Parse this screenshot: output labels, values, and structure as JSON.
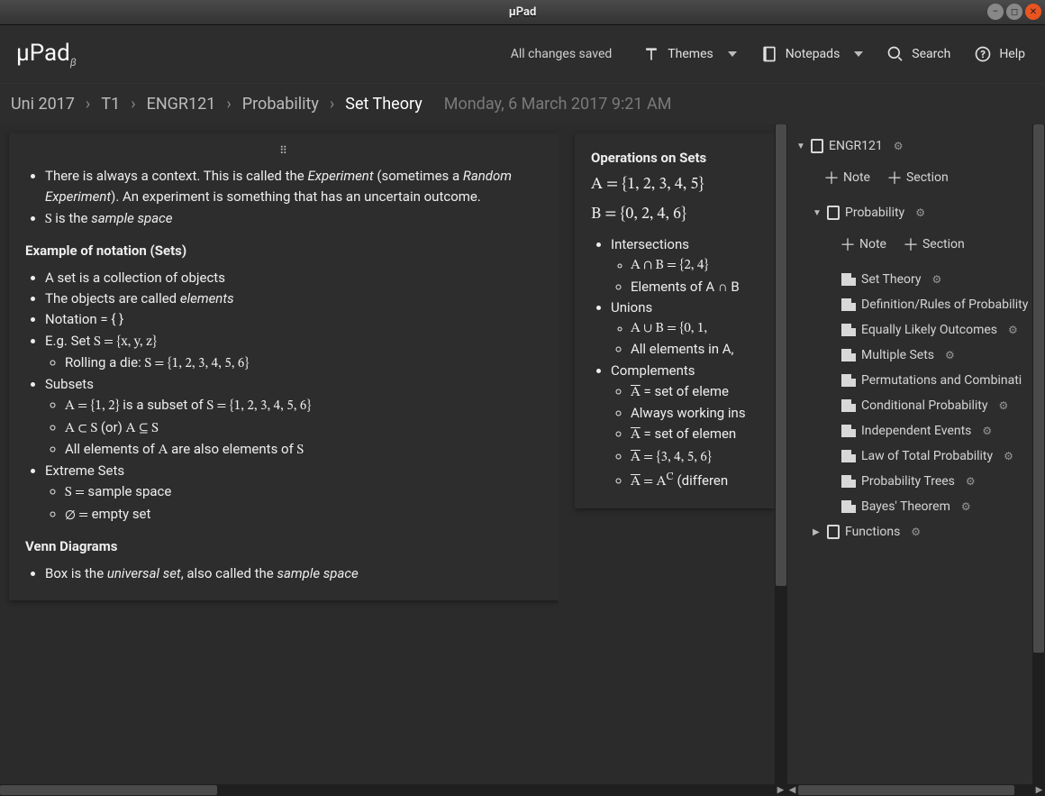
{
  "window": {
    "title": "µPad"
  },
  "brand": {
    "name": "µPad",
    "suffix": "β"
  },
  "topbar": {
    "saved_status": "All changes saved",
    "themes_label": "Themes",
    "notepads_label": "Notepads",
    "search_label": "Search",
    "help_label": "Help"
  },
  "breadcrumb": {
    "items": [
      "Uni 2017",
      "T1",
      "ENGR121",
      "Probability",
      "Set Theory"
    ],
    "timestamp": "Monday, 6 March 2017 9:21 AM"
  },
  "note1": {
    "line1a": "There is always a context. This is called the ",
    "line1b": "Experiment",
    "line1c": " (sometimes a ",
    "line1d": "Random Experiment",
    "line1e": "). An experiment is something that has an uncertain outcome.",
    "line2a": "S",
    "line2b": " is the ",
    "line2c": "sample space",
    "heading1": "Example of notation (Sets)",
    "l3": "A set is a collection of objects",
    "l4a": "The objects are called ",
    "l4b": "elements",
    "l5": "Notation = { }",
    "l6a": "E.g. Set ",
    "l6b": "S = {x, y, z}",
    "l6sub1a": "Rolling a die: ",
    "l6sub1b": "S = {1, 2, 3, 4, 5, 6}",
    "l7": "Subsets",
    "l7sub1a": "A = {1, 2}",
    "l7sub1b": " is a subset of ",
    "l7sub1c": "S = {1, 2, 3, 4, 5, 6}",
    "l7sub2a": "A ⊂ S",
    "l7sub2b": " (or) ",
    "l7sub2c": "A ⊆ S",
    "l7sub3a": "All elements of ",
    "l7sub3b": "A",
    "l7sub3c": " are also elements of ",
    "l7sub3d": "S",
    "l8": "Extreme Sets",
    "l8sub1a": "S = ",
    "l8sub1b": " sample space",
    "l8sub2a": "∅ = ",
    "l8sub2b": " empty set",
    "heading2": "Venn Diagrams",
    "l9a": "Box is the ",
    "l9b": "universal set",
    "l9c": ", also called the ",
    "l9d": "sample space"
  },
  "note2": {
    "heading": "Operations on Sets",
    "a_eq": "A = {1, 2, 3, 4, 5}",
    "b_eq": "B = {0, 2, 4, 6}",
    "i1": "Intersections",
    "i1a": "A ∩ B = {2, 4}",
    "i1b": "Elements of A ∩ B",
    "i2": "Unions",
    "i2a": "A ∪ B = {0, 1, ",
    "i2b": "All elements in A, ",
    "i3": "Complements",
    "i3a_pre": "A",
    "i3a_post": " =  set of eleme",
    "i3b": "Always working ins",
    "i3c_pre": "A",
    "i3c_post": " = set of elemen",
    "i3d_pre": "A",
    "i3d_post": " = {3, 4, 5, 6}",
    "i3e_pre": "A",
    "i3e_mid": " = A",
    "i3e_sup": "C",
    "i3e_post": " (differen"
  },
  "tree": {
    "engr": "ENGR121",
    "prob": "Probability",
    "add_note": "Note",
    "add_section": "Section",
    "pages": [
      "Set Theory",
      "Definition/Rules of Probability",
      "Equally Likely Outcomes",
      "Multiple Sets",
      "Permutations and Combinati",
      "Conditional Probability",
      "Independent Events",
      "Law of Total Probability",
      "Probability Trees",
      "Bayes' Theorem"
    ],
    "functions": "Functions"
  }
}
